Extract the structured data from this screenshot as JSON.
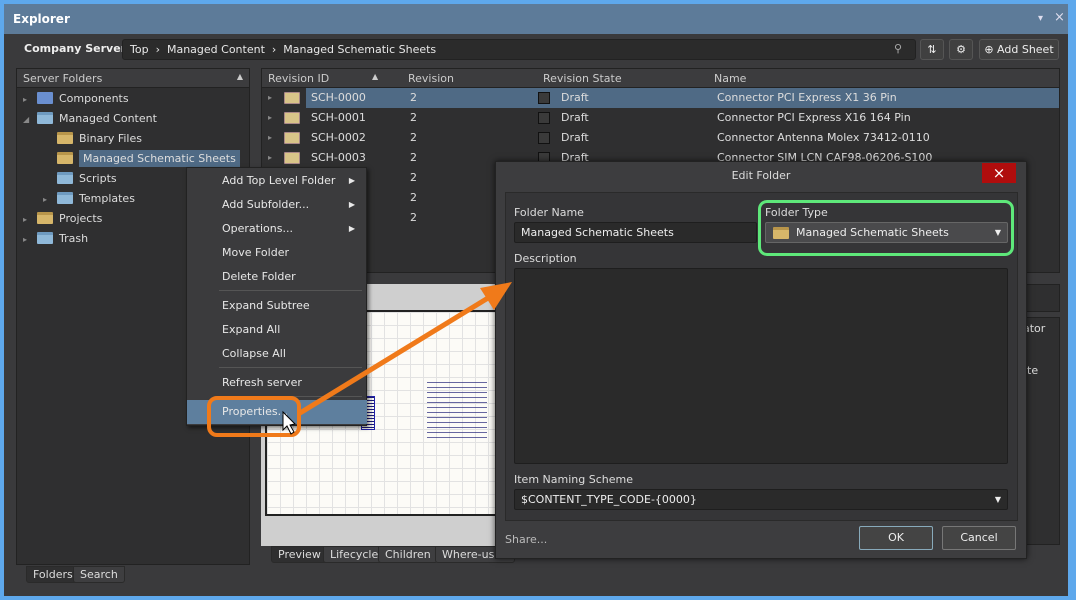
{
  "window": {
    "title": "Explorer",
    "pin": "▾",
    "close": "×"
  },
  "toolbar": {
    "server": "Company Server",
    "server_arrow": "▾",
    "breadcrumb": [
      "Top",
      "Managed Content",
      "Managed Schematic Sheets"
    ],
    "sep": "›",
    "add_sheet": "Add Sheet"
  },
  "folders": {
    "header": "Server Folders",
    "items": [
      {
        "label": "Components",
        "expander": "▸"
      },
      {
        "label": "Managed Content",
        "expander": "◢"
      },
      {
        "label": "Binary Files",
        "expander": ""
      },
      {
        "label": "Managed Schematic Sheets",
        "expander": ""
      },
      {
        "label": "Scripts",
        "expander": ""
      },
      {
        "label": "Templates",
        "expander": "▸"
      },
      {
        "label": "Projects",
        "expander": "▸"
      },
      {
        "label": "Trash",
        "expander": "▸"
      }
    ]
  },
  "grid": {
    "columns": [
      "Revision ID",
      "Revision",
      "Revision State",
      "Name"
    ],
    "rows": [
      {
        "id": "SCH-0000",
        "rev": "2",
        "state": "Draft",
        "name": "Connector PCI Express X1 36 Pin"
      },
      {
        "id": "SCH-0001",
        "rev": "2",
        "state": "Draft",
        "name": "Connector PCI Express X16 164 Pin"
      },
      {
        "id": "SCH-0002",
        "rev": "2",
        "state": "Draft",
        "name": "Connector Antenna Molex 73412-0110"
      },
      {
        "id": "SCH-0003",
        "rev": "2",
        "state": "Draft",
        "name": "Connector SIM LCN CAF98-06206-S100"
      },
      {
        "id": "",
        "rev": "2",
        "state": "",
        "name": ""
      },
      {
        "id": "",
        "rev": "2",
        "state": "",
        "name": ""
      },
      {
        "id": "",
        "rev": "2",
        "state": "",
        "name": ""
      }
    ]
  },
  "context_menu": [
    "Add Top Level Folder",
    "Add Subfolder...",
    "Operations...",
    "Move Folder",
    "Delete Folder",
    "Expand Subtree",
    "Expand All",
    "Collapse All",
    "Refresh server",
    "Properties..."
  ],
  "preview_tabs": [
    "Preview",
    "Lifecycle",
    "Children",
    "Where-used"
  ],
  "right_partial": {
    "a": "ator",
    "b": "te"
  },
  "bottom_tabs": [
    "Folders",
    "Search"
  ],
  "dialog": {
    "title": "Edit Folder",
    "folder_name_label": "Folder Name",
    "folder_name": "Managed Schematic Sheets",
    "folder_type_label": "Folder Type",
    "folder_type": "Managed Schematic Sheets",
    "description_label": "Description",
    "description": "",
    "naming_label": "Item Naming Scheme",
    "naming": "$CONTENT_TYPE_CODE-{0000}",
    "share": "Share...",
    "ok": "OK",
    "cancel": "Cancel",
    "close": "×"
  },
  "colors": {
    "highlight": "#5ee87a",
    "arrow": "#f07a1a",
    "selection": "#4f6a85"
  }
}
